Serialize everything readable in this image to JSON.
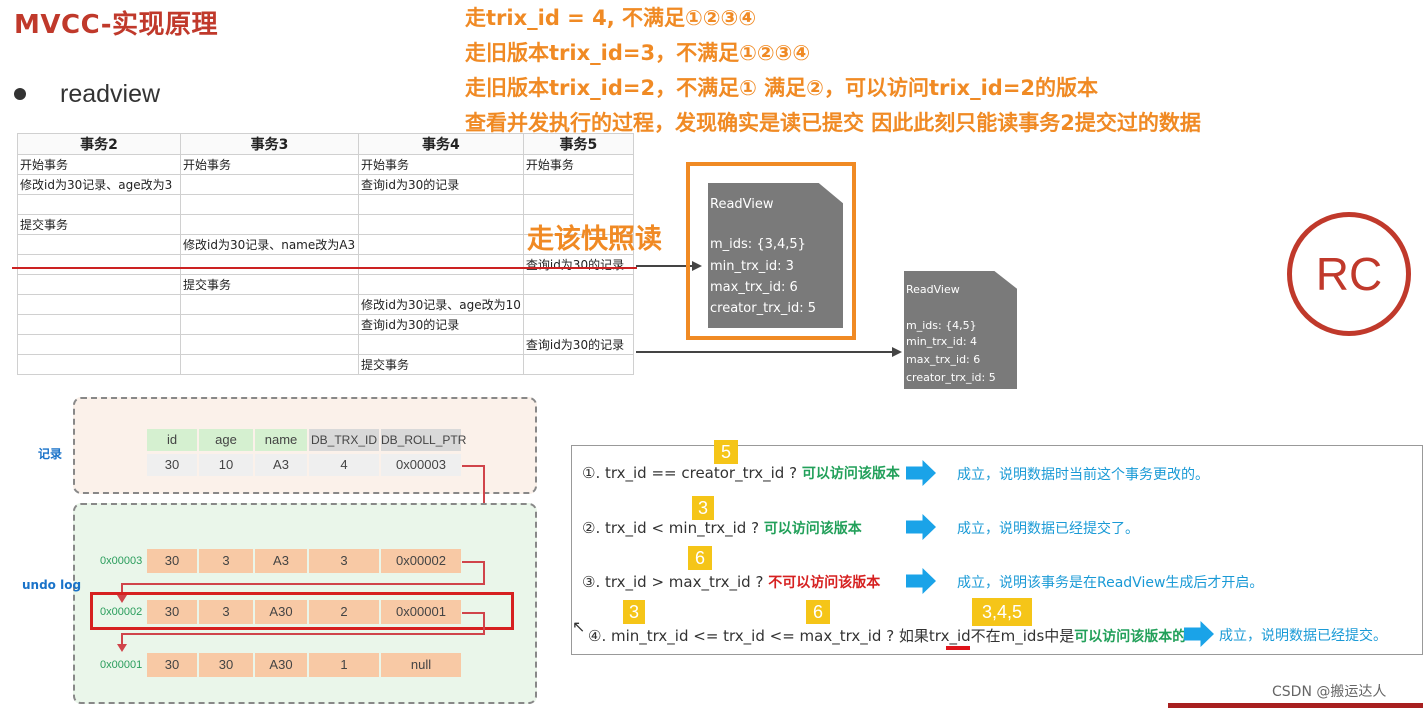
{
  "title": "MVCC-实现原理",
  "bullet": "readview",
  "notes": [
    "走trix_id = 4, 不满足①②③④",
    "走旧版本trix_id=3，不满足①②③④",
    "走旧版本trix_id=2，不满足① 满足②，可以访问trix_id=2的版本",
    "查看并发执行的过程，发现确实是读已提交 因此此刻只能读事务2提交过的数据"
  ],
  "snapshot_label": "走该快照读",
  "table": {
    "headers": [
      "事务2",
      "事务3",
      "事务4",
      "事务5"
    ],
    "rows": [
      [
        "开始事务",
        "开始事务",
        "开始事务",
        "开始事务"
      ],
      [
        "修改id为30记录、age改为3",
        "",
        "查询id为30的记录",
        ""
      ],
      [
        "",
        "",
        "",
        ""
      ],
      [
        "提交事务",
        "",
        "",
        ""
      ],
      [
        "",
        "修改id为30记录、name改为A3",
        "",
        ""
      ],
      [
        "",
        "",
        "",
        "查询id为30的记录"
      ],
      [
        "",
        "提交事务",
        "",
        ""
      ],
      [
        "",
        "",
        "修改id为30记录、age改为10",
        ""
      ],
      [
        "",
        "",
        "查询id为30的记录",
        ""
      ],
      [
        "",
        "",
        "",
        "查询id为30的记录"
      ],
      [
        "",
        "",
        "提交事务",
        ""
      ]
    ]
  },
  "readview1": {
    "title": "ReadView",
    "m_ids": "m_ids: {3,4,5}",
    "min_trx_id": "min_trx_id: 3",
    "max_trx_id": "max_trx_id: 6",
    "creator_trx_id": "creator_trx_id: 5"
  },
  "readview2": {
    "title": "ReadView",
    "m_ids": "m_ids: {4,5}",
    "min_trx_id": "min_trx_id: 4",
    "max_trx_id": "max_trx_id: 6",
    "creator_trx_id": "creator_trx_id: 5"
  },
  "rc_label": "RC",
  "record": {
    "label": "记录",
    "headers": [
      "id",
      "age",
      "name",
      "DB_TRX_ID",
      "DB_ROLL_PTR"
    ],
    "row": [
      "30",
      "10",
      "A3",
      "4",
      "0x00003"
    ]
  },
  "undo_log": {
    "label": "undo log",
    "rows": [
      {
        "addr": "0x00003",
        "cells": [
          "30",
          "3",
          "A3",
          "3",
          "0x00002"
        ]
      },
      {
        "addr": "0x00002",
        "cells": [
          "30",
          "3",
          "A30",
          "2",
          "0x00001"
        ]
      },
      {
        "addr": "0x00001",
        "cells": [
          "30",
          "30",
          "A30",
          "1",
          "null"
        ]
      }
    ]
  },
  "rules": [
    {
      "badge": "5",
      "text": "①. trx_id  == creator_trx_id ?",
      "verdict": "可以访问该版本",
      "result": "成立，说明数据时当前这个事务更改的。"
    },
    {
      "badge": "3",
      "text": "②. trx_id < min_trx_id ?",
      "verdict": "可以访问该版本",
      "result": "成立，说明数据已经提交了。"
    },
    {
      "badge": "6",
      "text": "③. trx_id > max_trx_id ?",
      "verdict": "不可以访问该版本",
      "result": "成立，说明该事务是在ReadView生成后才开启。"
    },
    {
      "badges": [
        "3",
        "6",
        "3,4,5"
      ],
      "text_a": "④. min_trx_id <= trx_id <= max_trx_id ?  如果trx_id",
      "text_b": "不在",
      "text_c": "m_ids中是",
      "verdict": "可以访问该版本的",
      "result": "成立，说明数据已经提交。"
    }
  ],
  "watermark": "CSDN @搬运达人",
  "colors": {
    "title_red": "#c0392b",
    "note_orange": "#f08a24",
    "readview_gray": "#7a7a7a",
    "access_green": "#22a05a",
    "deny_red": "#d62020",
    "result_blue": "#1a9ad6",
    "badge_yellow": "#f5c518",
    "undo_cell": "#f8c9a5"
  }
}
